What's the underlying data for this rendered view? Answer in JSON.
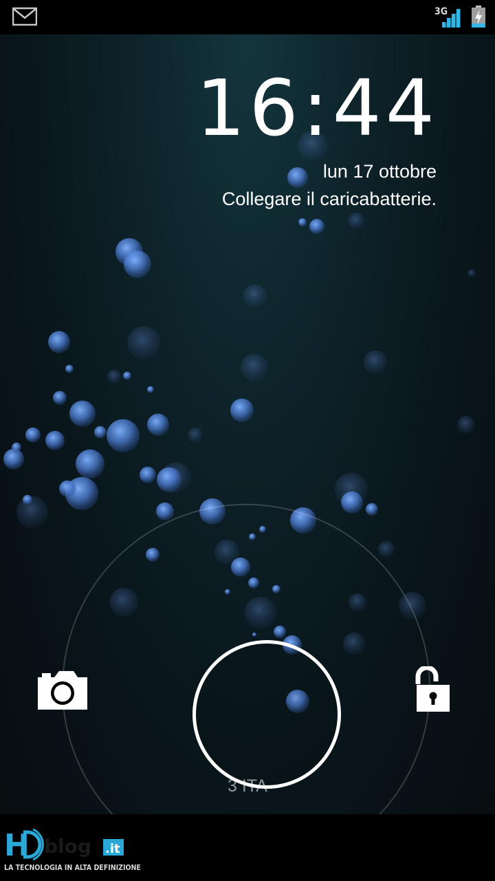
{
  "status_bar": {
    "notification_icon": "gmail-icon",
    "network_type": "3G",
    "signal_icon": "signal-strength-icon",
    "battery_icon": "battery-charging-icon"
  },
  "lock_screen": {
    "time": "16:44",
    "date": "lun 17 ottobre",
    "charging_message": "Collegare il caricabatterie.",
    "carrier": "3 ITA",
    "left_target_icon": "camera-icon",
    "right_target_icon": "unlock-icon",
    "handle": "unlock-handle"
  },
  "watermark": {
    "logo_icon": "hdblog-logo",
    "tagline": "LA TECNOLOGIA IN ALTA DEFINIZIONE",
    "accent_color": "#2aa8d8"
  }
}
